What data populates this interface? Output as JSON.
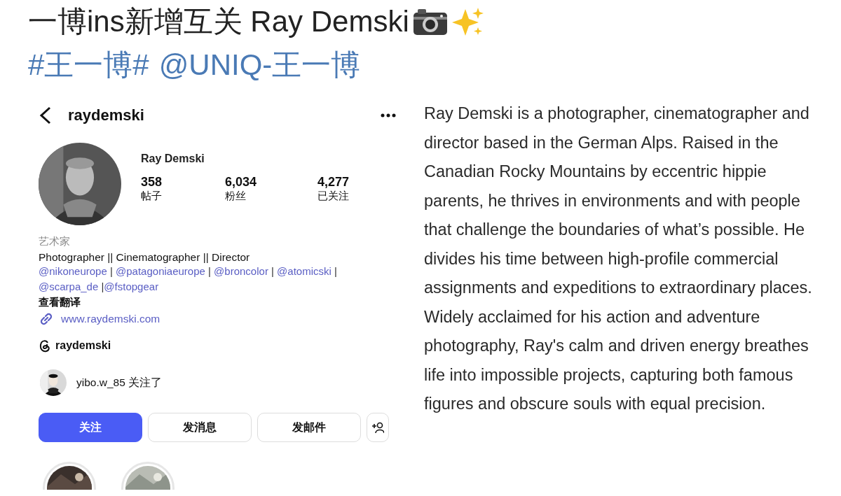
{
  "post": {
    "title": "一博ins新增互关 Ray Demski",
    "tags": [
      {
        "text": "#王一博#"
      },
      {
        "text": "@UNIQ-王一博"
      }
    ]
  },
  "profile": {
    "username": "raydemski",
    "name": "Ray Demski",
    "stats": [
      {
        "value": "358",
        "label": "帖子"
      },
      {
        "value": "6,034",
        "label": "粉丝"
      },
      {
        "value": "4,277",
        "label": "已关注"
      }
    ],
    "category": "艺术家",
    "bio": "Photographer || Cinematographer || Director",
    "mentions": [
      {
        "kind": "link",
        "text": "@nikoneurope"
      },
      {
        "kind": "plain",
        "text": " | "
      },
      {
        "kind": "link",
        "text": "@patagoniaeurope"
      },
      {
        "kind": "plain",
        "text": " | "
      },
      {
        "kind": "link",
        "text": "@broncolor"
      },
      {
        "kind": "plain",
        "text": " | "
      },
      {
        "kind": "link",
        "text": "@atomicski"
      },
      {
        "kind": "plain",
        "text": " | "
      },
      {
        "kind": "link",
        "text": "@scarpa_de"
      },
      {
        "kind": "plain",
        "text": " |"
      },
      {
        "kind": "link",
        "text": "@fstopgear"
      }
    ],
    "translate": "查看翻译",
    "website": "www.raydemski.com",
    "threads": "raydemski",
    "followed_by": "yibo.w_85 关注了",
    "buttons": [
      {
        "kind": "primary",
        "label": "关注"
      },
      {
        "kind": "secondary",
        "label": "发消息"
      },
      {
        "kind": "secondary",
        "label": "发邮件"
      },
      {
        "kind": "add-person"
      }
    ]
  },
  "description": "Ray Demski is a photographer, cinematographer and director based in the German Alps. Raised in the Canadian Rocky Mountains by eccentric hippie parents, he thrives in environments and with people that challenge the boundaries of what’s possible. He divides his time between high-profile commercial assignments and expeditions to extraordinary places. Widely acclaimed for his action and adventure photography, Ray's calm and driven energy breathes life into impossible projects, capturing both famous figures and obscure souls with equal precision."
}
